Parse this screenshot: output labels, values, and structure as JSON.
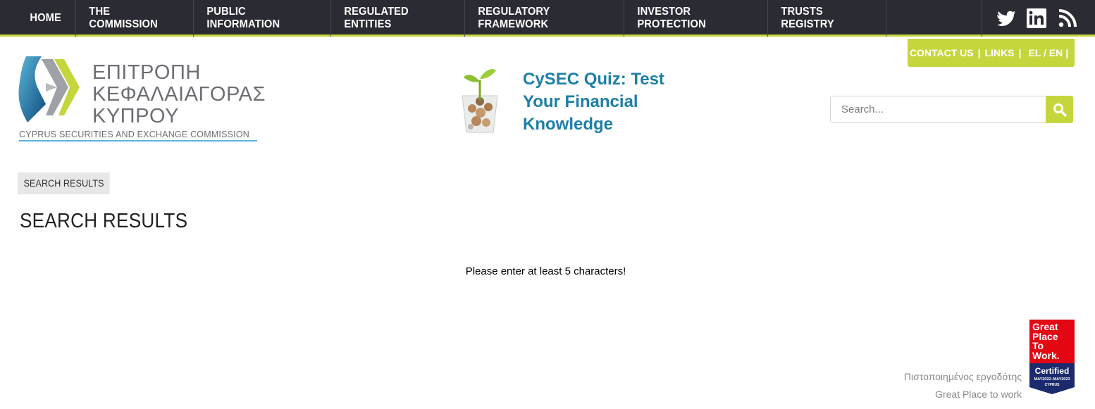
{
  "nav": {
    "items": [
      {
        "label": "HOME"
      },
      {
        "label": "THE COMMISSION"
      },
      {
        "label": "PUBLIC INFORMATION"
      },
      {
        "label": "REGULATED ENTITIES"
      },
      {
        "label": "REGULATORY FRAMEWORK"
      },
      {
        "label": "INVESTOR PROTECTION"
      },
      {
        "label": "TRUSTS REGISTRY"
      }
    ],
    "social": [
      "twitter-icon",
      "linkedin-icon",
      "rss-icon"
    ]
  },
  "utility": {
    "contact": "CONTACT US",
    "links": "LINKS",
    "language": "EL / EN",
    "separator": "|"
  },
  "logo": {
    "greek_line1": "ΕΠΙΤΡΟΠΗ",
    "greek_line2": "ΚΕΦΑΛΑΙΑΓΟΡΑΣ",
    "greek_line3": "ΚΥΠΡΟΥ",
    "english": "CYPRUS SECURITIES AND EXCHANGE COMMISSION"
  },
  "banner": {
    "line1": "CySEC Quiz: Test",
    "line2": "Your Financial",
    "line3": "Knowledge"
  },
  "search": {
    "placeholder": "Search..."
  },
  "breadcrumb": "SEARCH RESULTS",
  "page_title": "SEARCH RESULTS",
  "message": "Please enter at least 5 characters!",
  "gptw": {
    "text_line1": "Πιστοποιημένος εργοδότης",
    "text_line2": "Great Place to work",
    "badge_line1": "Great",
    "badge_line2": "Place",
    "badge_line3": "To",
    "badge_line4": "Work.",
    "badge_certified": "Certified",
    "badge_dates": "MAY2022–MAY2023",
    "badge_country": "CYPRUS"
  },
  "colors": {
    "nav_bg": "#2b2b33",
    "accent": "#c5d63d",
    "brand_blue": "#1d7fa6"
  }
}
